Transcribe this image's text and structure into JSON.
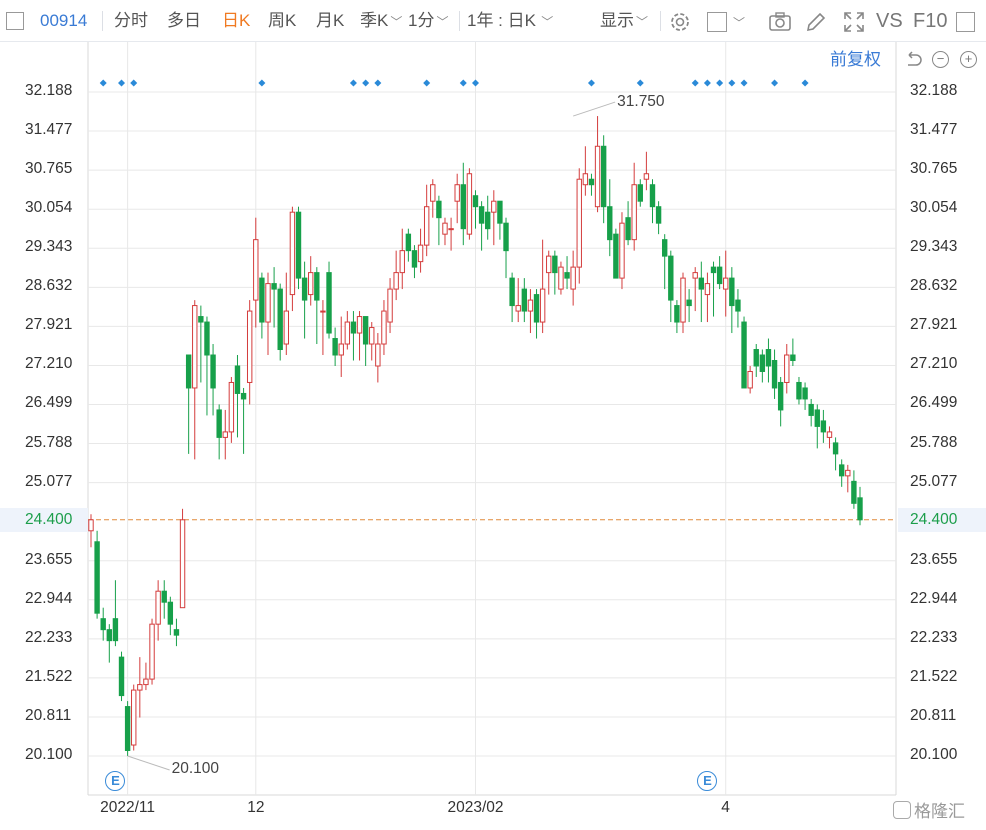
{
  "toolbar": {
    "code": "00914",
    "tabs": [
      "分时",
      "多日",
      "日K",
      "周K",
      "月K",
      "季K"
    ],
    "active_tab": "日K",
    "interval": "1分",
    "range": "1年 : 日K",
    "display": "显示",
    "vs": "VS",
    "f10": "F10"
  },
  "adjust_label": "前复权",
  "watermark": "格隆汇",
  "event_badge": "E",
  "colors": {
    "up": "#d43c3c",
    "down": "#17a04a",
    "grid": "#e8e8e8",
    "price_line": "#e08a3c",
    "marker": "#2a8ad8"
  },
  "chart_data": {
    "type": "candlestick",
    "current_price": "24.400",
    "y_ticks": [
      "32.188",
      "31.477",
      "30.765",
      "30.054",
      "29.343",
      "28.632",
      "27.921",
      "27.210",
      "26.499",
      "25.788",
      "25.077",
      "24.400",
      "23.655",
      "22.944",
      "22.233",
      "21.522",
      "20.811",
      "20.100"
    ],
    "ylim": [
      20.1,
      32.188
    ],
    "x_ticks": [
      {
        "label": "2022/11",
        "day": 6
      },
      {
        "label": "12",
        "day": 27
      },
      {
        "label": "2023/02",
        "day": 63
      },
      {
        "label": "4",
        "day": 104
      }
    ],
    "max_annotation": {
      "label": "31.750",
      "day": 79,
      "value": 31.75
    },
    "min_annotation": {
      "label": "20.100",
      "day": 6,
      "value": 20.1
    },
    "event_days": [
      4,
      101
    ],
    "marker_days": [
      2,
      5,
      7,
      28,
      43,
      45,
      47,
      55,
      61,
      63,
      82,
      90,
      99,
      101,
      103,
      105,
      107,
      112,
      117
    ],
    "ohlc": [
      [
        24.2,
        24.4,
        23.9,
        24.5
      ],
      [
        24.0,
        22.7,
        22.6,
        24.2
      ],
      [
        22.6,
        22.4,
        22.2,
        22.8
      ],
      [
        22.4,
        22.2,
        21.8,
        22.5
      ],
      [
        22.6,
        22.2,
        22.1,
        23.3
      ],
      [
        21.9,
        21.2,
        21.1,
        22.0
      ],
      [
        21.0,
        20.2,
        20.1,
        21.1
      ],
      [
        20.3,
        21.3,
        20.2,
        21.4
      ],
      [
        21.3,
        21.4,
        20.8,
        21.9
      ],
      [
        21.4,
        21.5,
        21.3,
        21.8
      ],
      [
        21.5,
        22.5,
        21.4,
        22.6
      ],
      [
        22.5,
        23.1,
        22.2,
        23.3
      ],
      [
        23.1,
        22.9,
        22.6,
        23.3
      ],
      [
        22.9,
        22.5,
        22.3,
        23.0
      ],
      [
        22.4,
        22.3,
        22.1,
        22.6
      ],
      [
        22.8,
        24.4,
        22.8,
        24.6
      ],
      [
        27.4,
        26.8,
        25.6,
        27.4
      ],
      [
        26.8,
        28.3,
        25.5,
        28.4
      ],
      [
        28.1,
        28.0,
        26.9,
        28.3
      ],
      [
        28.0,
        27.4,
        26.3,
        28.1
      ],
      [
        27.4,
        26.8,
        26.3,
        27.6
      ],
      [
        26.4,
        25.9,
        25.5,
        26.5
      ],
      [
        25.9,
        26.0,
        25.5,
        26.4
      ],
      [
        26.0,
        26.9,
        25.8,
        27.0
      ],
      [
        27.2,
        26.7,
        25.9,
        27.4
      ],
      [
        26.7,
        26.6,
        25.6,
        26.8
      ],
      [
        26.9,
        28.2,
        26.5,
        28.4
      ],
      [
        28.4,
        29.5,
        27.9,
        29.9
      ],
      [
        28.8,
        28.0,
        27.7,
        28.9
      ],
      [
        28.0,
        28.7,
        27.4,
        28.9
      ],
      [
        28.7,
        28.6,
        27.9,
        29.0
      ],
      [
        28.6,
        27.5,
        27.3,
        28.7
      ],
      [
        27.6,
        28.2,
        27.4,
        28.9
      ],
      [
        28.5,
        30.0,
        28.2,
        30.1
      ],
      [
        30.0,
        28.8,
        28.6,
        30.1
      ],
      [
        28.8,
        28.4,
        27.7,
        29.1
      ],
      [
        28.5,
        28.9,
        28.3,
        29.2
      ],
      [
        28.9,
        28.4,
        27.6,
        29.0
      ],
      [
        28.2,
        28.2,
        27.4,
        28.4
      ],
      [
        28.9,
        27.8,
        27.7,
        29.1
      ],
      [
        27.7,
        27.4,
        27.2,
        27.9
      ],
      [
        27.4,
        27.6,
        27.0,
        28.1
      ],
      [
        27.6,
        28.0,
        27.5,
        28.2
      ],
      [
        28.0,
        27.8,
        27.3,
        28.2
      ],
      [
        27.8,
        28.1,
        27.3,
        28.2
      ],
      [
        28.1,
        27.6,
        27.2,
        28.1
      ],
      [
        27.6,
        27.9,
        27.3,
        28.0
      ],
      [
        27.2,
        27.6,
        26.9,
        27.8
      ],
      [
        27.6,
        28.2,
        27.4,
        28.4
      ],
      [
        28.0,
        28.6,
        27.8,
        28.8
      ],
      [
        28.6,
        28.9,
        28.4,
        29.3
      ],
      [
        28.9,
        29.3,
        28.6,
        29.7
      ],
      [
        29.6,
        29.3,
        29.1,
        29.7
      ],
      [
        29.3,
        29.0,
        28.8,
        29.4
      ],
      [
        29.1,
        29.4,
        28.9,
        29.7
      ],
      [
        29.4,
        30.1,
        29.2,
        30.5
      ],
      [
        30.2,
        30.5,
        29.9,
        30.6
      ],
      [
        30.2,
        29.9,
        29.4,
        30.3
      ],
      [
        29.6,
        29.8,
        29.4,
        29.9
      ],
      [
        29.7,
        29.7,
        29.3,
        29.9
      ],
      [
        30.2,
        30.5,
        29.8,
        30.7
      ],
      [
        30.5,
        29.7,
        29.4,
        30.9
      ],
      [
        29.6,
        30.7,
        29.5,
        30.8
      ],
      [
        30.3,
        30.1,
        29.7,
        30.4
      ],
      [
        30.1,
        29.8,
        29.3,
        30.2
      ],
      [
        30.0,
        29.7,
        29.5,
        30.3
      ],
      [
        30.0,
        30.2,
        29.4,
        30.4
      ],
      [
        30.2,
        29.8,
        29.5,
        30.2
      ],
      [
        29.8,
        29.3,
        28.8,
        29.9
      ],
      [
        28.8,
        28.3,
        28.0,
        28.9
      ],
      [
        28.2,
        28.3,
        28.0,
        28.8
      ],
      [
        28.6,
        28.2,
        28.0,
        28.8
      ],
      [
        28.2,
        28.4,
        27.8,
        28.6
      ],
      [
        28.5,
        28.0,
        27.7,
        28.6
      ],
      [
        28.0,
        28.6,
        27.8,
        29.5
      ],
      [
        28.9,
        29.2,
        28.5,
        29.3
      ],
      [
        29.2,
        28.9,
        28.5,
        29.3
      ],
      [
        28.6,
        29.0,
        28.5,
        29.1
      ],
      [
        28.9,
        28.8,
        28.6,
        29.2
      ],
      [
        28.6,
        29.0,
        28.3,
        29.3
      ],
      [
        29.0,
        30.6,
        28.7,
        30.8
      ],
      [
        30.5,
        30.7,
        30.3,
        31.2
      ],
      [
        30.6,
        30.5,
        30.3,
        30.7
      ],
      [
        30.1,
        31.2,
        30.0,
        31.75
      ],
      [
        31.2,
        30.1,
        29.8,
        31.4
      ],
      [
        30.1,
        29.5,
        29.2,
        30.6
      ],
      [
        29.6,
        28.8,
        28.8,
        29.7
      ],
      [
        28.8,
        29.8,
        28.6,
        30.0
      ],
      [
        29.9,
        29.5,
        29.4,
        30.2
      ],
      [
        29.5,
        30.5,
        29.3,
        30.9
      ],
      [
        30.5,
        30.2,
        30.1,
        30.6
      ],
      [
        30.6,
        30.7,
        30.4,
        31.1
      ],
      [
        30.5,
        30.1,
        29.8,
        30.6
      ],
      [
        30.1,
        29.8,
        29.6,
        30.2
      ],
      [
        29.5,
        29.2,
        28.6,
        29.6
      ],
      [
        29.2,
        28.4,
        28.0,
        29.3
      ],
      [
        28.3,
        28.0,
        27.8,
        28.4
      ],
      [
        28.0,
        28.8,
        27.8,
        28.9
      ],
      [
        28.4,
        28.3,
        28.0,
        28.6
      ],
      [
        28.8,
        28.9,
        28.2,
        29.0
      ],
      [
        28.8,
        28.6,
        28.0,
        29.1
      ],
      [
        28.5,
        28.7,
        28.0,
        28.9
      ],
      [
        29.0,
        28.9,
        28.1,
        29.1
      ],
      [
        29.0,
        28.7,
        28.6,
        29.2
      ],
      [
        28.6,
        28.8,
        28.1,
        29.3
      ],
      [
        28.8,
        28.3,
        27.8,
        29.0
      ],
      [
        28.4,
        28.2,
        27.9,
        28.6
      ],
      [
        28.0,
        26.8,
        26.8,
        28.1
      ],
      [
        26.8,
        27.1,
        26.7,
        27.2
      ],
      [
        27.5,
        27.2,
        27.0,
        27.6
      ],
      [
        27.4,
        27.1,
        26.9,
        27.5
      ],
      [
        27.5,
        27.2,
        26.9,
        27.7
      ],
      [
        27.3,
        26.8,
        26.6,
        27.5
      ],
      [
        26.9,
        26.4,
        26.1,
        27.0
      ],
      [
        26.9,
        27.4,
        26.7,
        27.6
      ],
      [
        27.4,
        27.3,
        27.2,
        27.7
      ],
      [
        26.9,
        26.6,
        26.5,
        27.0
      ],
      [
        26.8,
        26.6,
        26.4,
        26.9
      ],
      [
        26.5,
        26.3,
        26.1,
        26.6
      ],
      [
        26.4,
        26.1,
        25.7,
        26.5
      ],
      [
        26.2,
        26.0,
        25.8,
        26.4
      ],
      [
        25.9,
        26.0,
        25.7,
        26.1
      ],
      [
        25.8,
        25.6,
        25.3,
        25.9
      ],
      [
        25.4,
        25.2,
        25.0,
        25.5
      ],
      [
        25.2,
        25.3,
        24.9,
        25.4
      ],
      [
        25.1,
        24.7,
        24.6,
        25.3
      ],
      [
        24.8,
        24.4,
        24.3,
        25.0
      ]
    ]
  }
}
